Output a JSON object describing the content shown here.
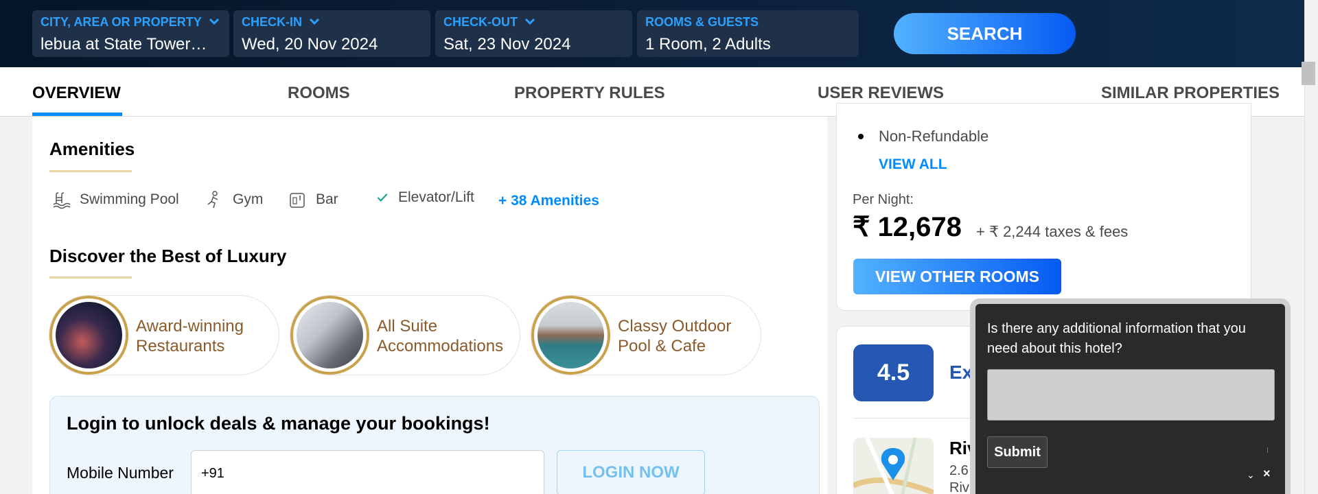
{
  "search": {
    "city": {
      "label": "CITY, AREA OR PROPERTY",
      "value": "lebua at State Tower…"
    },
    "checkin": {
      "label": "CHECK-IN",
      "value": "Wed, 20 Nov 2024"
    },
    "checkout": {
      "label": "CHECK-OUT",
      "value": "Sat, 23 Nov 2024"
    },
    "rooms": {
      "label": "ROOMS & GUESTS",
      "value": "1 Room, 2 Adults"
    },
    "button": "SEARCH"
  },
  "tabs": [
    "OVERVIEW",
    "ROOMS",
    "PROPERTY RULES",
    "USER REVIEWS",
    "SIMILAR PROPERTIES"
  ],
  "amenities": {
    "title": "Amenities",
    "items": [
      "Swimming Pool",
      "Gym",
      "Bar",
      "Elevator/Lift"
    ],
    "more": "+ 38 Amenities"
  },
  "luxury": {
    "title": "Discover the Best of Luxury",
    "cards": [
      {
        "line1": "Award-winning",
        "line2": "Restaurants"
      },
      {
        "line1": "All Suite",
        "line2": "Accommodations"
      },
      {
        "line1": "Classy Outdoor",
        "line2": "Pool & Cafe"
      }
    ]
  },
  "login": {
    "title": "Login to unlock deals & manage your bookings!",
    "mobile_label": "Mobile Number",
    "mobile_value": "+91",
    "button": "LOGIN NOW"
  },
  "pricing": {
    "policy": "Non-Refundable",
    "view_all": "VIEW ALL",
    "per_night": "Per Night:",
    "price": "₹ 12,678",
    "taxes": "+ ₹ 2,244 taxes & fees",
    "button": "VIEW OTHER ROOMS"
  },
  "rating": {
    "score": "4.5",
    "label": "Ex"
  },
  "location": {
    "title": "Riv",
    "sub1": "2.6",
    "sub2": "Riv"
  },
  "chat": {
    "question": "Is there any additional information that you need about this hotel?",
    "submit": "Submit",
    "close": "×",
    "minimize": "⌄"
  },
  "colors": {
    "accent": "#008cff",
    "rating": "#2558b2",
    "gold": "#c9a24b"
  }
}
